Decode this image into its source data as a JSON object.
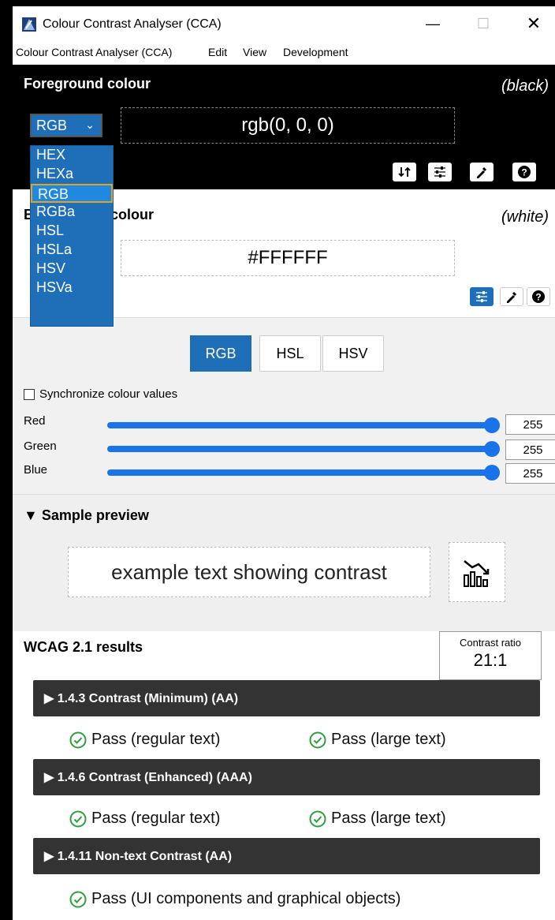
{
  "window": {
    "title": "Colour Contrast Analyser (CCA)"
  },
  "menu": [
    "Colour Contrast Analyser (CCA)",
    "Edit",
    "View",
    "Development"
  ],
  "foreground": {
    "title": "Foreground colour",
    "name": "(black)",
    "format": "RGB",
    "value": "rgb(0, 0, 0)",
    "format_options": [
      "HEX",
      "HEXa",
      "RGB",
      "RGBa",
      "HSL",
      "HSLa",
      "HSV",
      "HSVa"
    ],
    "selected_format_option": "RGB"
  },
  "background": {
    "title": "Background colour",
    "name": "(white)",
    "value": "#FFFFFF"
  },
  "sliders": {
    "tabs": [
      "RGB",
      "HSL",
      "HSV"
    ],
    "active_tab": "RGB",
    "sync_label": "Synchronize colour values",
    "sync_checked": false,
    "channels": [
      {
        "label": "Red",
        "value": "255"
      },
      {
        "label": "Green",
        "value": "255"
      },
      {
        "label": "Blue",
        "value": "255"
      }
    ]
  },
  "preview": {
    "title": "▼ Sample preview",
    "text": "example text showing contrast"
  },
  "results": {
    "title": "WCAG 2.1 results",
    "ratio_label": "Contrast ratio",
    "ratio_value": "21:1",
    "criteria": [
      {
        "title": "▶ 1.4.3 Contrast (Minimum) (AA)",
        "pass_regular": "Pass (regular text)",
        "pass_large": "Pass (large text)"
      },
      {
        "title": "▶ 1.4.6 Contrast (Enhanced) (AAA)",
        "pass_regular": "Pass (regular text)",
        "pass_large": "Pass (large text)"
      },
      {
        "title": "▶ 1.4.11 Non-text Contrast (AA)",
        "pass_ui": "Pass (UI components and graphical objects)"
      }
    ]
  },
  "colors": {
    "accent": "#1f6fb8",
    "pass": "#2e9e3e",
    "criterion_bg": "#333333"
  },
  "icons": [
    "swap-icon",
    "sliders-icon",
    "eyedropper-icon",
    "help-icon",
    "chart-icon",
    "check-circle-icon"
  ]
}
